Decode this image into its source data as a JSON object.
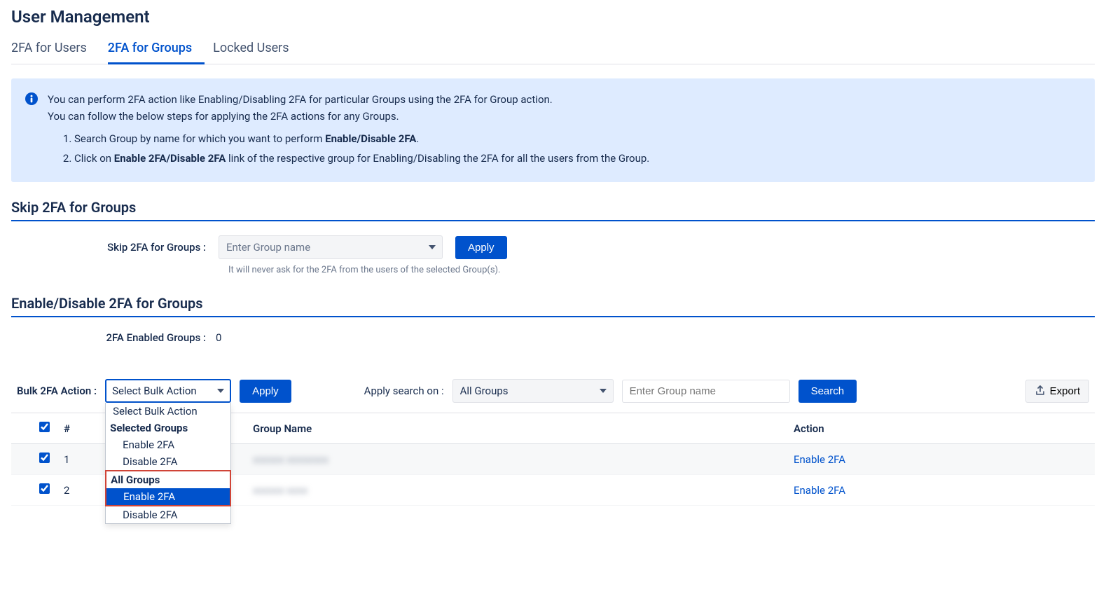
{
  "page": {
    "title": "User Management"
  },
  "tabs": {
    "users": "2FA for Users",
    "groups": "2FA for Groups",
    "locked": "Locked Users"
  },
  "info": {
    "line1": "You can perform 2FA action like Enabling/Disabling 2FA for particular Groups using the 2FA for Group action.",
    "line2": "You can follow the below steps for applying the 2FA actions for any Groups.",
    "step1_pre": "Search Group by name for which you want to perform ",
    "step1_bold": "Enable/Disable 2FA",
    "step1_post": ".",
    "step2_pre": "Click on ",
    "step2_bold": "Enable 2FA/Disable 2FA",
    "step2_post": " link of the respective group for Enabling/Disabling the 2FA for all the users from the Group."
  },
  "skip": {
    "heading": "Skip 2FA for Groups",
    "label": "Skip 2FA for Groups :",
    "placeholder": "Enter Group name",
    "apply": "Apply",
    "hint": "It will never ask for the 2FA from the users of the selected Group(s)."
  },
  "enable": {
    "heading": "Enable/Disable 2FA for Groups",
    "count_label": "2FA Enabled Groups :",
    "count_value": "0"
  },
  "bar": {
    "bulk_label": "Bulk 2FA Action :",
    "bulk_selected": "Select Bulk Action",
    "apply": "Apply",
    "filter_label": "Apply search on :",
    "filter_selected": "All Groups",
    "search_placeholder": "Enter Group name",
    "search": "Search",
    "export": "Export"
  },
  "dropdown": {
    "opt1": "Select Bulk Action",
    "group1": "Selected Groups",
    "g1_enable": "Enable 2FA",
    "g1_disable": "Disable 2FA",
    "group2": "All Groups",
    "g2_enable": "Enable 2FA",
    "g2_disable": "Disable 2FA"
  },
  "table": {
    "h1": "#",
    "h2": "Group Name",
    "h3": "Action",
    "rows": [
      {
        "idx": "1",
        "name": "xxxxxx xxxxxxxx",
        "action": "Enable 2FA"
      },
      {
        "idx": "2",
        "name": "xxxxxx xxxx",
        "action": "Enable 2FA"
      }
    ]
  }
}
